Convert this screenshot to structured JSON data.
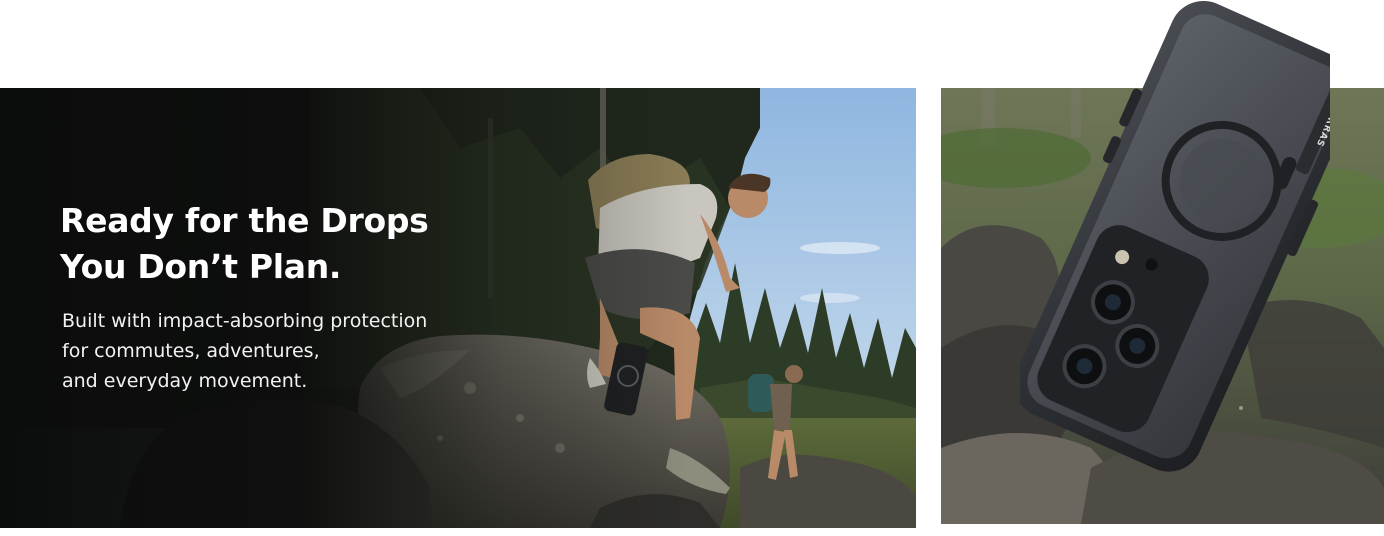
{
  "hero": {
    "title_lines": [
      "Ready for the Drops",
      "You Don’t Plan."
    ],
    "subtitle_lines": [
      "Built with impact-absorbing protection",
      "for commutes, adventures,",
      "and everyday movement."
    ]
  },
  "product": {
    "brand_mark": "TORRAS"
  },
  "colors": {
    "text": "#ffffff",
    "sky": "#a9c8e6",
    "forest": "#2f3a2a",
    "rock": "#5d5a52",
    "phone_case": "#2f3236"
  }
}
